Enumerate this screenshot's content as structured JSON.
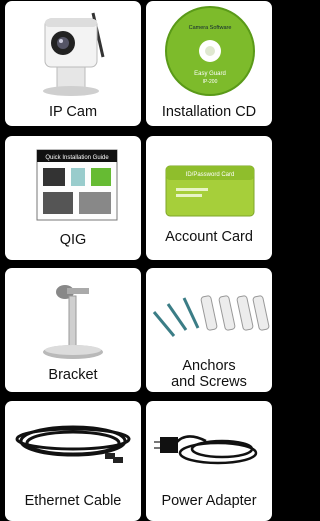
{
  "items": [
    {
      "label": "IP Cam"
    },
    {
      "label": "Installation CD",
      "disc_text": "Camera Software",
      "disc_brand": "Easy Guard",
      "disc_model": "IP-200"
    },
    {
      "label": "QIG",
      "guide_title": "Quick Installation Guide"
    },
    {
      "label": "Account Card",
      "card_title": "ID/Password Card"
    },
    {
      "label": "Bracket"
    },
    {
      "label_line1": "Anchors",
      "label_line2": "and Screws"
    },
    {
      "label": "Ethernet Cable"
    },
    {
      "label": "Power Adapter"
    }
  ]
}
